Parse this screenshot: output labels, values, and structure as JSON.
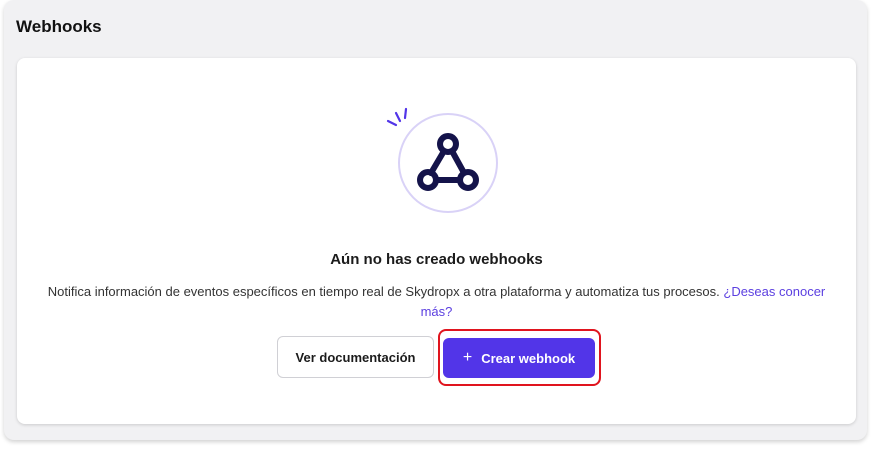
{
  "header": {
    "title": "Webhooks"
  },
  "empty_state": {
    "illustration_icon": "webhook-icon",
    "title": "Aún no has creado webhooks",
    "description": "Notifica información de eventos específicos en tiempo real de Skydropx a otra plataforma y automatiza tus procesos.",
    "learn_more_link": "¿Deseas conocer más?"
  },
  "actions": {
    "docs_button_label": "Ver documentación",
    "create_button_icon": "plus-icon",
    "create_button_label": "Crear webhook"
  },
  "colors": {
    "primary": "#5235e8",
    "link": "#5b3fe0",
    "highlight": "#e0141e",
    "icon_dark": "#14134a",
    "icon_circle_border": "#d9d2f7"
  }
}
